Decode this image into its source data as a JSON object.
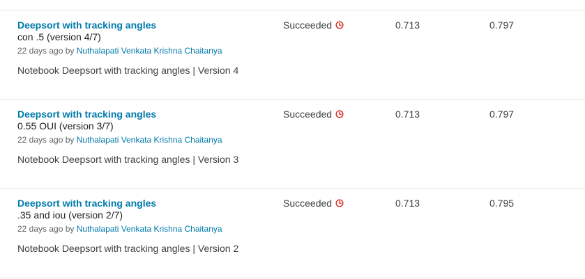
{
  "rows": [
    {
      "title": "Deepsort with tracking angles",
      "subtitle": "con .5 (version 4/7)",
      "age": "22 days ago by ",
      "author": "Nuthalapati Venkata Krishna Chaitanya",
      "notebook": "Notebook Deepsort with tracking angles | Version 4",
      "status": "Succeeded",
      "status_icon": "clock-icon",
      "public_score": "0.713",
      "private_score": "0.797"
    },
    {
      "title": "Deepsort with tracking angles",
      "subtitle": "0.55 OUI (version 3/7)",
      "age": "22 days ago by ",
      "author": "Nuthalapati Venkata Krishna Chaitanya",
      "notebook": "Notebook Deepsort with tracking angles | Version 3",
      "status": "Succeeded",
      "status_icon": "clock-icon",
      "public_score": "0.713",
      "private_score": "0.797"
    },
    {
      "title": "Deepsort with tracking angles",
      "subtitle": ".35 and iou (version 2/7)",
      "age": "22 days ago by ",
      "author": "Nuthalapati Venkata Krishna Chaitanya",
      "notebook": "Notebook Deepsort with tracking angles | Version 2",
      "status": "Succeeded",
      "status_icon": "clock-icon",
      "public_score": "0.713",
      "private_score": "0.795"
    }
  ],
  "colors": {
    "link": "#007aab",
    "status_icon": "#d93025",
    "divider": "#e6e6e6"
  }
}
